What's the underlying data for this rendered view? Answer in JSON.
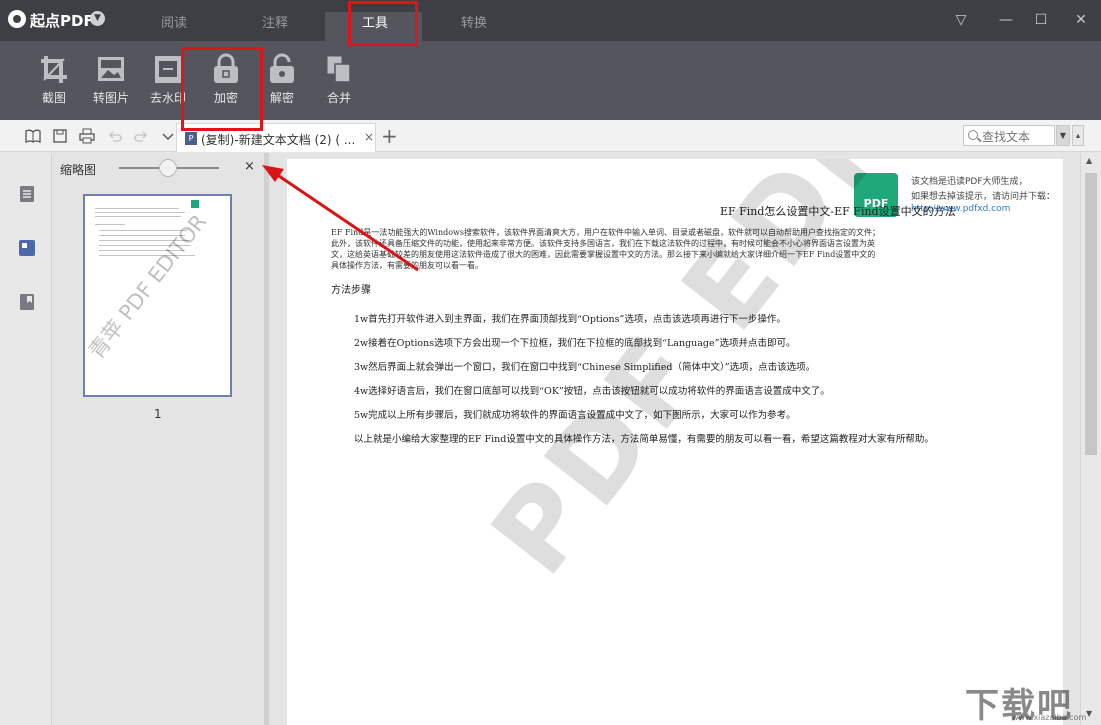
{
  "titlebar": {
    "app_name": "起点PDF",
    "tabs": [
      {
        "label": "阅读"
      },
      {
        "label": "注释"
      },
      {
        "label": "工具"
      },
      {
        "label": "转换"
      }
    ]
  },
  "ribbon": {
    "tools": [
      {
        "label": "截图",
        "icon": "crop-icon"
      },
      {
        "label": "转图片",
        "icon": "image-icon"
      },
      {
        "label": "去水印",
        "icon": "watermark-icon"
      },
      {
        "label": "加密",
        "icon": "lock-icon"
      },
      {
        "label": "解密",
        "icon": "unlock-icon"
      },
      {
        "label": "合并",
        "icon": "merge-icon"
      }
    ]
  },
  "docbar": {
    "tab_badge": "P",
    "tab_title": "(复制)-新建文本文档 (2) ( ...",
    "tab_close": "×",
    "add_tab": "+",
    "search_placeholder": "查找文本"
  },
  "thumbnails": {
    "title": "缩略图",
    "close": "×",
    "page_number": "1",
    "watermark": "青苹 PDF EDITOR"
  },
  "page": {
    "watermark_logo": "PDF",
    "watermark_line1": "该文档是迅读PDF大师生成，",
    "watermark_line2": "如果想去掉该提示，请访问并下载：",
    "watermark_url": "http://www.pdfxd.com",
    "title": "EF Find怎么设置中文-EF Find设置中文的方法",
    "intro": "EF Find是一法功能强大的Windows搜索软件，该软件界面清爽大方，用户在软件中输入单词、目录或者磁盘，软件就可以自动帮助用户查找指定的文件；此外，该软件还具备压缩文件的功能，使用起来非常方便。该软件支持多国语言，我们在下载这法软件的过程中，有时候可能会不小心将界面语言设置为英文，这给英语基础较差的朋友使用这法软件造成了很大的困难，因此需要掌握设置中文的方法。那么接下来小编就给大家详细介绍一下EF Find设置中文的具体操作方法，有需要的朋友可以看一看。",
    "heading": "方法步骤",
    "steps": [
      "1w首先打开软件进入到主界面，我们在界面顶部找到“Options”选项，点击该选项再进行下一步操作。",
      "2w接着在Options选项下方会出现一个下拉框，我们在下拉框的底部找到“Language”选项并点击即可。",
      "3w然后界面上就会弹出一个窗口，我们在窗口中找到“Chinese Simplified（简体中文）”选项，点击该选项。",
      "4w选择好语言后，我们在窗口底部可以找到“OK”按钮，点击该按钮就可以成功将软件的界面语言设置成中文了。",
      "5w完成以上所有步骤后，我们就成功将软件的界面语言设置成中文了，如下图所示，大家可以作为参考。",
      "以上就是小编给大家整理的EF Find设置中文的具体操作方法，方法简单易懂，有需要的朋友可以看一看，希望这篇教程对大家有所帮助。"
    ],
    "big_watermark": "PDF EDITOR"
  },
  "site_watermark": "下载吧",
  "site_watermark_url": "www.xiazaiba.com",
  "colors": {
    "titlebar": "#3e3e45",
    "ribbon": "#55555e",
    "annotation": "#e0141a"
  }
}
